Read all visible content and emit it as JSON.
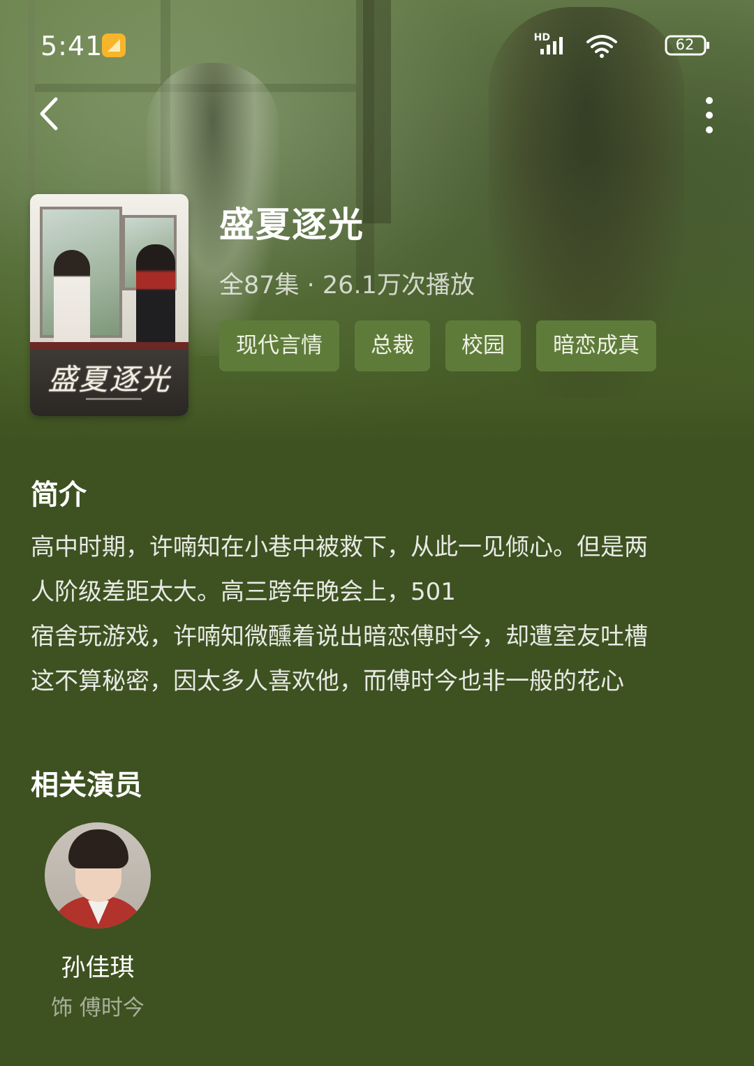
{
  "status_bar": {
    "time": "5:41",
    "network_label": "HD",
    "battery_level": "62",
    "icons": [
      "notification-icon",
      "signal-icon",
      "wifi-icon",
      "battery-icon"
    ]
  },
  "nav": {
    "back_icon": "chevron-left-icon",
    "more_icon": "more-vertical-icon"
  },
  "drama": {
    "poster_title": "盛夏逐光",
    "title": "盛夏逐光",
    "meta": "全87集 · 26.1万次播放",
    "tags": [
      "现代言情",
      "总裁",
      "校园",
      "暗恋成真"
    ]
  },
  "synopsis": {
    "heading": "简介",
    "lines": [
      "高中时期，许喃知在小巷中被救下，从此一见倾心。但是两",
      "人阶级差距太大。高三跨年晚会上，501",
      "宿舍玩游戏，许喃知微醺着说出暗恋傅时今，却遭室友吐槽",
      "这不算秘密，因太多人喜欢他，而傅时今也非一般的花心"
    ]
  },
  "cast": {
    "heading": "相关演员",
    "actors": [
      {
        "name": "孙佳琪",
        "role": "饰 傅时今"
      }
    ]
  },
  "colors": {
    "page_background": "#3e5121",
    "tag_background": "#5f7b3a",
    "accent_status": "#f6b52a"
  }
}
